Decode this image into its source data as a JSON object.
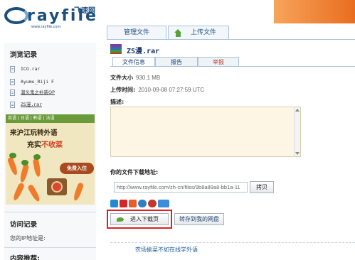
{
  "header": {
    "logo_text": "rayfile",
    "logo_cn": "飞速网",
    "logo_url": "www.rayfile.com",
    "accent_color": "#ee7c2c",
    "brand_color": "#1a4f7e"
  },
  "top_tabs": {
    "manage": "管理文件",
    "upload": "上传文件"
  },
  "sidebar": {
    "history_title": "浏览记录",
    "history": [
      {
        "label": "ICO.rar"
      },
      {
        "label": "Ayumu_Riji F"
      },
      {
        "label": "溜头鬼之补新OP"
      },
      {
        "label": "ZS漫.rar"
      }
    ],
    "ad": {
      "strip": "英语 | 日语 | 韩语 | 法语",
      "line1": "来沪江玩转外语",
      "line2_prefix": "充实",
      "line2_highlight": "不收菜",
      "button": "免费入住"
    },
    "visit_title": "访问记录",
    "ip_label": "您的IP地址是:",
    "recommend_title": "内容推荐:"
  },
  "file": {
    "title": "ZS漫.rar",
    "tabs": {
      "info": "文件信息",
      "report": "报告",
      "abuse": "举报"
    },
    "size_label": "文件大小",
    "size_value": "930.1 MB",
    "time_label": "上传时间:",
    "time_value": "2010-09-08 07:27:59 UTC",
    "desc_label": "描述:",
    "download_label": "你的文件下载地址:",
    "download_url": "http://www.rayfile.com/zh-cn/files/9b8a89a8-bb1a-11",
    "copy_button": "拷贝",
    "share_icons": [
      "qq-icon",
      "renren-icon",
      "kaixin-icon",
      "douban-icon",
      "sina-icon",
      "live-icon"
    ],
    "enter_button": "进入下载页",
    "save_button": "转存到我的网盘",
    "bottom_link": "农场偷菜不如在线学外语"
  }
}
